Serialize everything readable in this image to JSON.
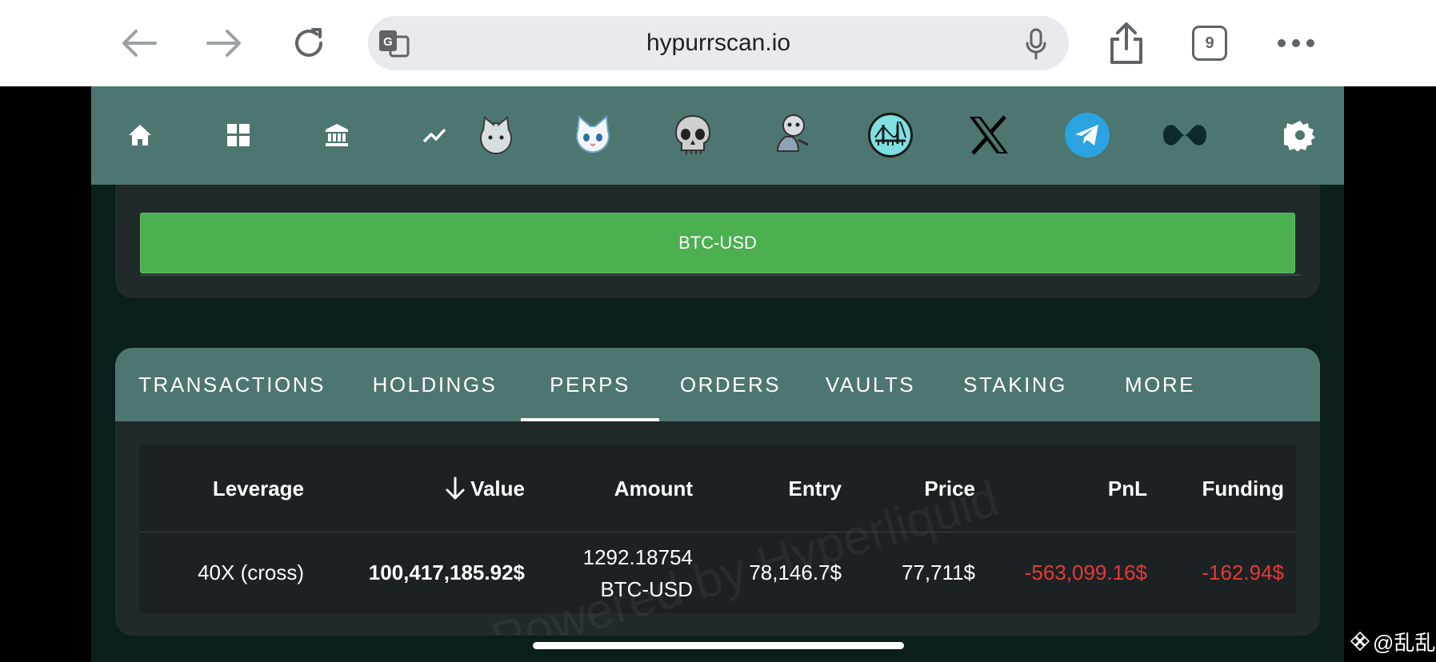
{
  "browser": {
    "url": "hypurrscan.io",
    "tab_count": "9",
    "icons": [
      "back-arrow-icon",
      "forward-arrow-icon",
      "reload-icon",
      "translate-icon",
      "microphone-icon",
      "share-icon",
      "more-icon"
    ]
  },
  "top_nav": {
    "icons": [
      "home-icon",
      "dashboard-icon",
      "bank-icon",
      "chart-line-icon",
      "cat-mascot-icon",
      "white-cat-icon",
      "skull-icon",
      "cartoon-character-icon",
      "bridge-logo-icon",
      "x-logo-icon",
      "telegram-icon",
      "hyperliquid-logo-icon",
      "settings-icon"
    ]
  },
  "market_button": {
    "label": "BTC-USD",
    "color": "#4caf50"
  },
  "tabs": [
    {
      "label": "TRANSACTIONS",
      "active": false
    },
    {
      "label": "HOLDINGS",
      "active": false
    },
    {
      "label": "PERPS",
      "active": true
    },
    {
      "label": "ORDERS",
      "active": false
    },
    {
      "label": "VAULTS",
      "active": false
    },
    {
      "label": "STAKING",
      "active": false
    },
    {
      "label": "MORE",
      "active": false
    }
  ],
  "table": {
    "headers": {
      "leverage": "Leverage",
      "value": "Value",
      "amount": "Amount",
      "entry": "Entry",
      "price": "Price",
      "pnl": "PnL",
      "funding": "Funding"
    },
    "sort_icon": "arrow-down-icon",
    "rows": [
      {
        "leverage": "40X (cross)",
        "value": "100,417,185.92$",
        "amount_qty": "1292.18754",
        "amount_symbol": "BTC-USD",
        "entry": "78,146.7$",
        "price": "77,711$",
        "pnl": "-563,099.16$",
        "funding": "-162.94$"
      }
    ]
  },
  "watermark": "Powered by Hyperliquid",
  "corner_mark": "@乱乱",
  "colors": {
    "nav_bg": "#4e7670",
    "page_bg": "#0a1e1b",
    "card_bg": "#212a2a",
    "negative": "#e53935"
  }
}
